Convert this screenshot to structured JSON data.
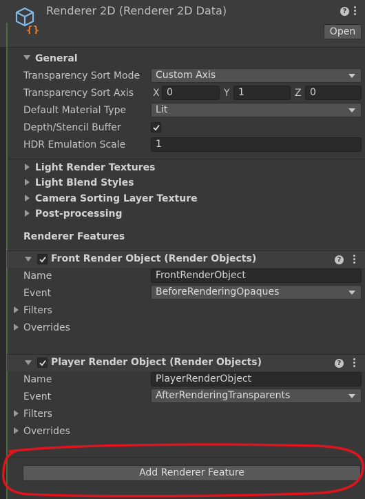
{
  "header": {
    "title": "Renderer 2D (Renderer 2D Data)",
    "open_label": "Open"
  },
  "general": {
    "section_label": "General",
    "transparency_sort_mode": {
      "label": "Transparency Sort Mode",
      "value": "Custom Axis"
    },
    "transparency_sort_axis": {
      "label": "Transparency Sort Axis",
      "x_label": "X",
      "x": "0",
      "y_label": "Y",
      "y": "1",
      "z_label": "Z",
      "z": "0"
    },
    "default_material_type": {
      "label": "Default Material Type",
      "value": "Lit"
    },
    "depth_stencil_buffer": {
      "label": "Depth/Stencil Buffer",
      "checked": true
    },
    "hdr_emulation_scale": {
      "label": "HDR Emulation Scale",
      "value": "1"
    }
  },
  "foldouts": [
    "Light Render Textures",
    "Light Blend Styles",
    "Camera Sorting Layer Texture",
    "Post-processing"
  ],
  "renderer_features_label": "Renderer Features",
  "features": [
    {
      "title": "Front Render Object (Render Objects)",
      "name_label": "Name",
      "name": "FrontRenderObject",
      "event_label": "Event",
      "event": "BeforeRenderingOpaques",
      "filters": "Filters",
      "overrides": "Overrides"
    },
    {
      "title": "Player Render Object (Render Objects)",
      "name_label": "Name",
      "name": "PlayerRenderObject",
      "event_label": "Event",
      "event": "AfterRenderingTransparents",
      "filters": "Filters",
      "overrides": "Overrides"
    }
  ],
  "add_feature_label": "Add Renderer Feature",
  "icons": {
    "asset": "scriptable-object-icon",
    "help": "help-icon",
    "menu": "kebab-menu-icon"
  },
  "colors": {
    "annotation": "#e0141e",
    "background": "#383838",
    "field": "#2a2a2a"
  }
}
